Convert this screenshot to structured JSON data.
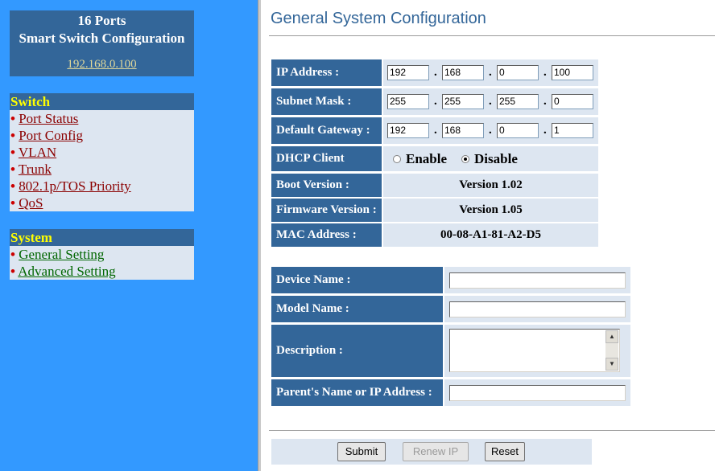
{
  "sidebar": {
    "title_line1": "16 Ports",
    "title_line2": "Smart Switch Configuration",
    "ip_link": "192.168.0.100",
    "switch_group": {
      "heading": "Switch",
      "items": [
        "Port Status",
        "Port Config",
        "VLAN",
        "Trunk",
        "802.1p/TOS Priority",
        "QoS"
      ]
    },
    "system_group": {
      "heading": "System",
      "items": [
        "General Setting",
        "Advanced Setting"
      ]
    },
    "bullet": "•"
  },
  "main": {
    "title": "General System Configuration",
    "ip_address": {
      "label": "IP Address :",
      "octets": [
        "192",
        "168",
        "0",
        "100"
      ]
    },
    "subnet_mask": {
      "label": "Subnet Mask :",
      "octets": [
        "255",
        "255",
        "255",
        "0"
      ]
    },
    "default_gateway": {
      "label": "Default Gateway :",
      "octets": [
        "192",
        "168",
        "0",
        "1"
      ]
    },
    "octet_separator": ".",
    "dhcp": {
      "label": "DHCP Client",
      "enable": "Enable",
      "disable": "Disable",
      "selected": "Disable"
    },
    "boot_version": {
      "label": "Boot Version :",
      "value": "Version 1.02"
    },
    "firmware_version": {
      "label": "Firmware Version :",
      "value": "Version 1.05"
    },
    "mac_address": {
      "label": "MAC Address :",
      "value": "00-08-A1-81-A2-D5"
    },
    "device_name": {
      "label": "Device Name :",
      "value": ""
    },
    "model_name": {
      "label": "Model Name :",
      "value": ""
    },
    "description": {
      "label": "Description :",
      "value": ""
    },
    "parent_name": {
      "label": "Parent's Name or IP Address :",
      "value": ""
    }
  },
  "buttons": {
    "submit": "Submit",
    "renew_ip": "Renew IP",
    "reset": "Reset"
  },
  "icons": {
    "scroll_up": "▲",
    "scroll_down": "▼"
  },
  "colors": {
    "sidebar_bg": "#3399ff",
    "header_bg": "#336699",
    "cell_bg": "#dde6f1",
    "switch_link": "#8b0000",
    "system_link": "#006600"
  }
}
